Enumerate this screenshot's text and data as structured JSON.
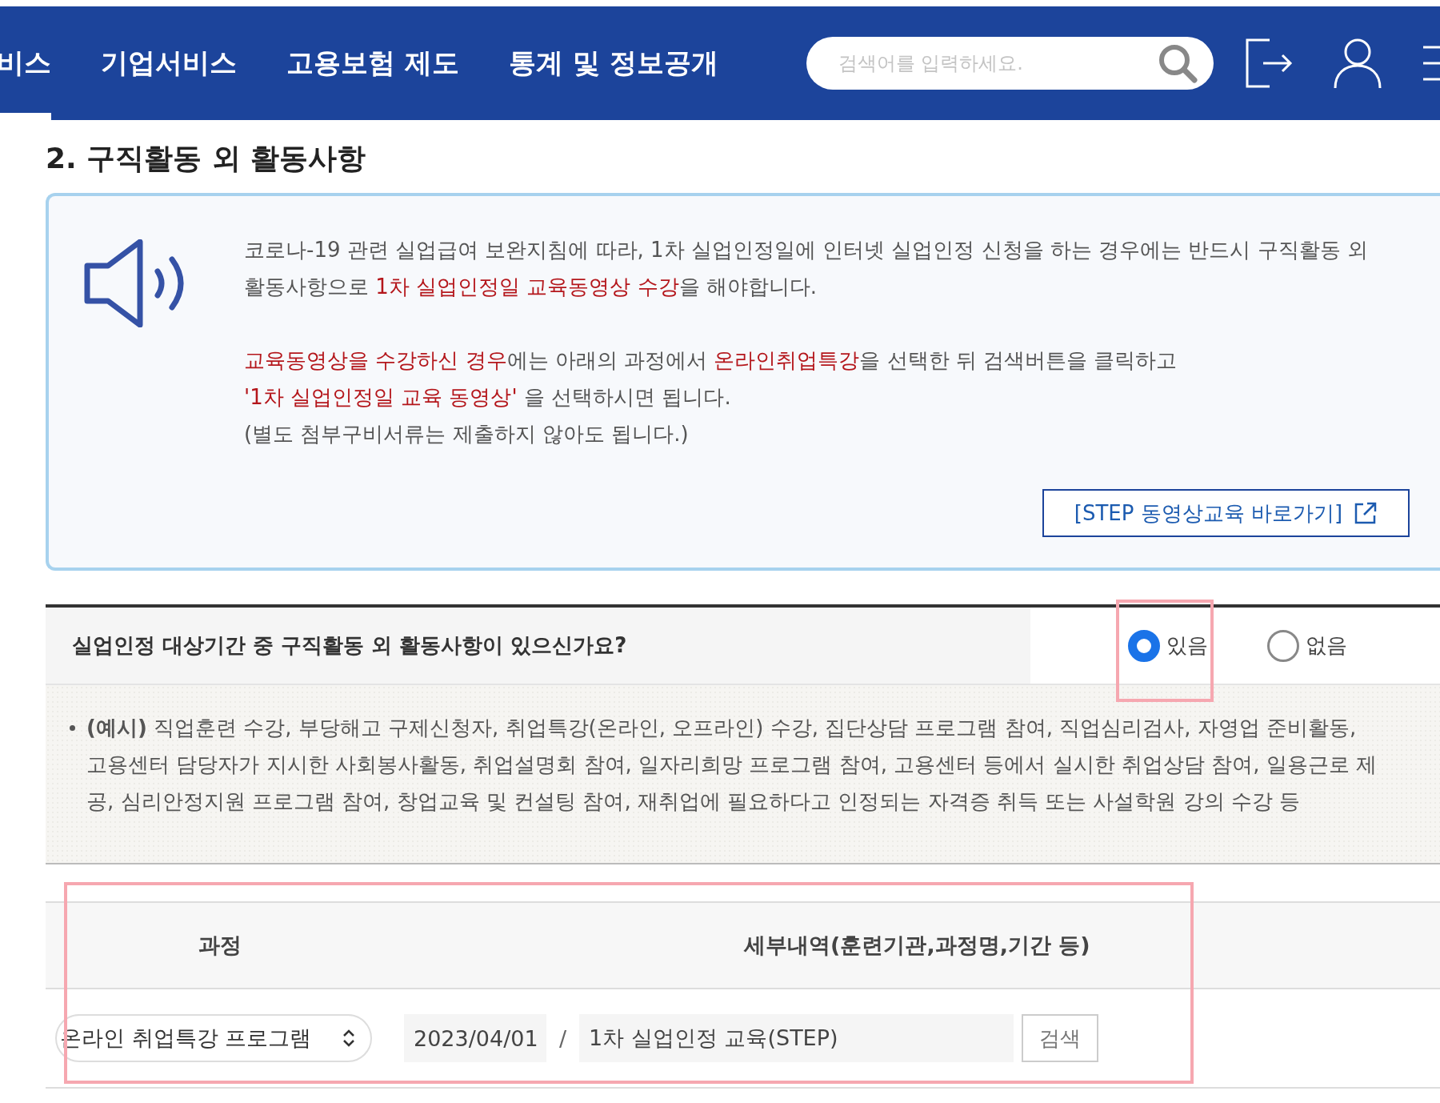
{
  "nav": {
    "items": [
      {
        "label": "비스",
        "selected": true
      },
      {
        "label": "기업서비스",
        "selected": false
      },
      {
        "label": "고용보험 제도",
        "selected": false
      },
      {
        "label": "통계 및 정보공개",
        "selected": false
      }
    ],
    "search": {
      "placeholder": "검색어를 입력하세요."
    }
  },
  "section_title": "2. 구직활동 외 활동사항",
  "notice": {
    "paragraphs": [
      "코로나-19 관련 실업급여 보완지침에 따라, 1차 실업인정일에 인터넷 실업인정 신청을 하는 경우에는 반드시 구직활동 외 활동사항으로 **1차 실업인정일 교육동영상 수강**을 해야합니다.",
      "**교육동영상을 수강하신 경우**에는 아래의 과정에서 **온라인취업특강**을 선택한 뒤 검색버튼을 클릭하고\n**'1차 실업인정일 교육 동영상'** 을 선택하시면 됩니다.\n(별도 첨부구비서류는 제출하지 않아도 됩니다.)"
    ],
    "link_button": "[STEP 동영상교육 바로가기]"
  },
  "question": {
    "text": "실업인정 대상기간 중 구직활동 외 활동사항이 있으신가요?",
    "options": [
      {
        "label": "있음",
        "selected": true,
        "highlighted": true
      },
      {
        "label": "없음",
        "selected": false,
        "highlighted": false
      }
    ]
  },
  "examples": {
    "label": "(예시)",
    "text": "직업훈련 수강, 부당해고 구제신청자, 취업특강(온라인, 오프라인) 수강, 집단상담 프로그램 참여, 직업심리검사, 자영업 준비활동, 고용센터 담당자가 지시한 사회봉사활동, 취업설명회 참여, 일자리희망 프로그램 참여, 고용센터 등에서 실시한 취업상담 참여, 일용근로 제공, 심리안정지원 프로그램 참여, 창업교육 및 컨설팅 참여, 재취업에 필요하다고 인정되는 자격증 취득 또는 사설학원 강의 수강 등"
  },
  "table": {
    "highlighted": true,
    "columns": [
      "과정",
      "세부내역(훈련기관,과정명,기간 등)"
    ],
    "row": {
      "course": "온라인 취업특강 프로그램",
      "date": "2023/04/01",
      "separator": "/",
      "detail": "1차 실업인정 교육(STEP)",
      "search_button": "검색"
    }
  }
}
